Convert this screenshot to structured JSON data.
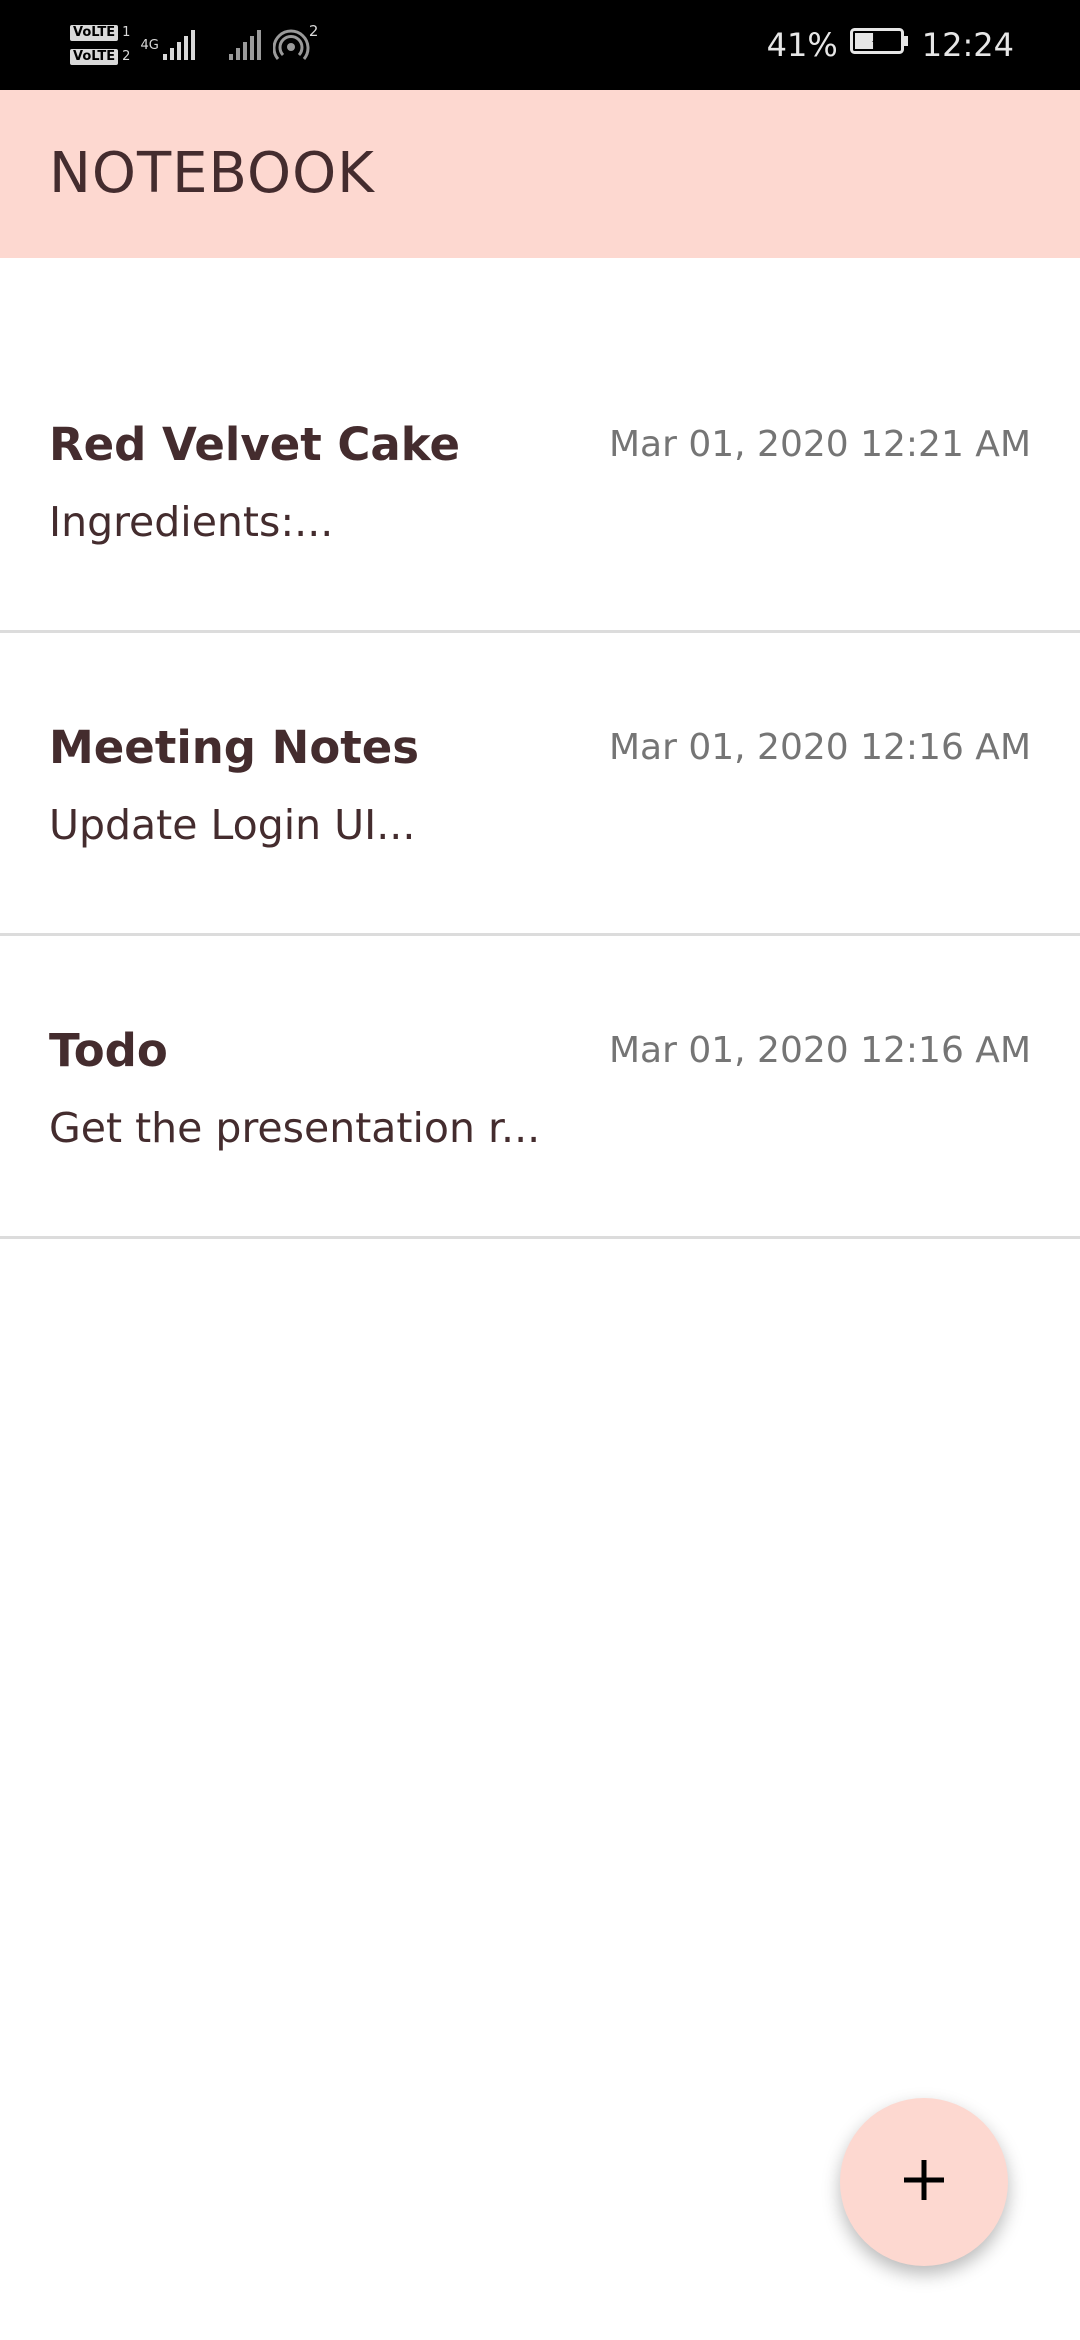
{
  "status_bar": {
    "sim1_label": "VoLTE",
    "sim1_num": "1",
    "sim2_label": "VoLTE",
    "sim2_num": "2",
    "network_type": "4G",
    "hotspot_count": "2",
    "battery_percent": "41%",
    "battery_level": 0.41,
    "time": "12:24"
  },
  "app_bar": {
    "title": "NOTEBOOK"
  },
  "notes": [
    {
      "title": "Red Velvet Cake",
      "date": "Mar 01, 2020 12:21 AM",
      "preview": "Ingredients:..."
    },
    {
      "title": "Meeting Notes",
      "date": "Mar 01, 2020 12:16 AM",
      "preview": "Update Login UI..."
    },
    {
      "title": "Todo",
      "date": "Mar 01, 2020 12:16 AM",
      "preview": "Get the presentation r..."
    }
  ],
  "fab": {
    "icon": "plus-icon"
  },
  "colors": {
    "accent": "#fdd8d0",
    "text_primary": "#442c2e",
    "text_secondary": "#757575",
    "divider": "#dcdcdc"
  }
}
